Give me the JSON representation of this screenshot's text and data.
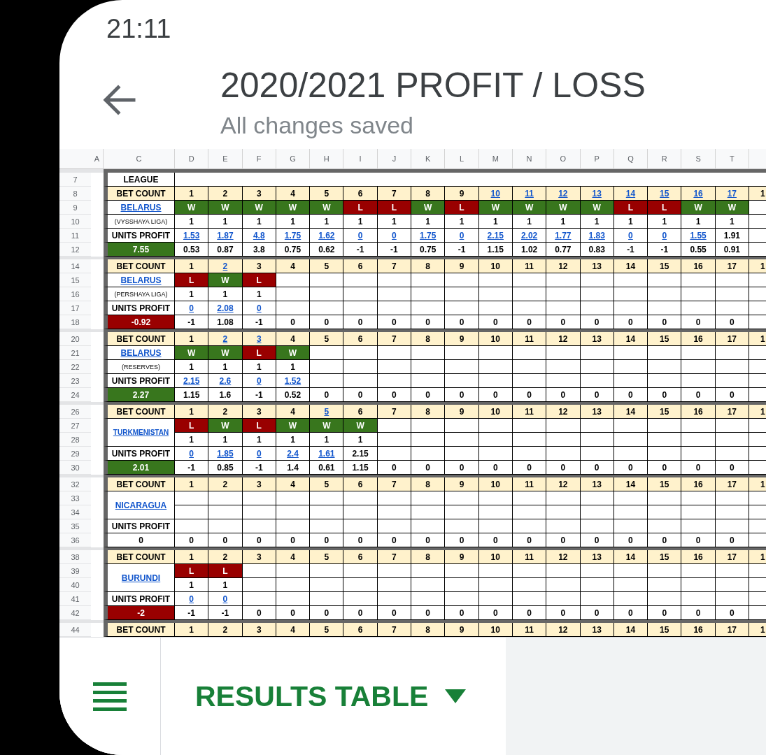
{
  "status_bar": {
    "time": "21:11"
  },
  "header": {
    "title": "2020/2021 PROFIT / LOSS",
    "subtitle": "All changes saved"
  },
  "sheet": {
    "columns": [
      "A",
      "C",
      "D",
      "E",
      "F",
      "G",
      "H",
      "I",
      "J",
      "K",
      "L",
      "M",
      "N",
      "O",
      "P",
      "Q",
      "R",
      "S",
      "T"
    ],
    "league_row": {
      "number": "7",
      "label": "LEAGUE"
    },
    "blocks": [
      {
        "rows": [
          {
            "number": "8",
            "kind": "bet_count",
            "label": "BET COUNT",
            "cells": [
              {
                "text": "1",
                "link": false
              },
              {
                "text": "2",
                "link": false
              },
              {
                "text": "3",
                "link": false
              },
              {
                "text": "4",
                "link": false
              },
              {
                "text": "5",
                "link": false
              },
              {
                "text": "6",
                "link": false
              },
              {
                "text": "7",
                "link": false
              },
              {
                "text": "8",
                "link": false
              },
              {
                "text": "9",
                "link": false
              },
              {
                "text": "10",
                "link": true
              },
              {
                "text": "11",
                "link": true
              },
              {
                "text": "12",
                "link": true
              },
              {
                "text": "13",
                "link": true
              },
              {
                "text": "14",
                "link": true
              },
              {
                "text": "15",
                "link": true
              },
              {
                "text": "16",
                "link": true
              },
              {
                "text": "17",
                "link": true
              },
              {
                "text": "1",
                "link": false
              }
            ]
          },
          {
            "number": "9",
            "kind": "result",
            "label": "BELARUS",
            "cells": [
              {
                "text": "W",
                "color": "#38761d"
              },
              {
                "text": "W",
                "color": "#38761d"
              },
              {
                "text": "W",
                "color": "#38761d"
              },
              {
                "text": "W",
                "color": "#38761d"
              },
              {
                "text": "W",
                "color": "#38761d"
              },
              {
                "text": "L",
                "color": "#990000"
              },
              {
                "text": "L",
                "color": "#990000"
              },
              {
                "text": "W",
                "color": "#38761d"
              },
              {
                "text": "L",
                "color": "#990000"
              },
              {
                "text": "W",
                "color": "#38761d"
              },
              {
                "text": "W",
                "color": "#38761d"
              },
              {
                "text": "W",
                "color": "#38761d"
              },
              {
                "text": "W",
                "color": "#38761d"
              },
              {
                "text": "L",
                "color": "#990000"
              },
              {
                "text": "L",
                "color": "#990000"
              },
              {
                "text": "W",
                "color": "#38761d"
              },
              {
                "text": "W",
                "color": "#38761d"
              }
            ]
          },
          {
            "number": "10",
            "kind": "stake",
            "label": "(VYSSHAYA LIGA)",
            "cells": [
              "1",
              "1",
              "1",
              "1",
              "1",
              "1",
              "1",
              "1",
              "1",
              "1",
              "1",
              "1",
              "1",
              "1",
              "1",
              "1",
              "1"
            ]
          },
          {
            "number": "11",
            "kind": "profit",
            "label": "UNITS PROFIT",
            "cells": [
              {
                "text": "1.53",
                "link": true
              },
              {
                "text": "1.87",
                "link": true
              },
              {
                "text": "4.8",
                "link": true
              },
              {
                "text": "1.75",
                "link": true
              },
              {
                "text": "1.62",
                "link": true
              },
              {
                "text": "0",
                "link": true
              },
              {
                "text": "0",
                "link": true
              },
              {
                "text": "1.75",
                "link": true
              },
              {
                "text": "0",
                "link": true
              },
              {
                "text": "2.15",
                "link": true
              },
              {
                "text": "2.02",
                "link": true
              },
              {
                "text": "1.77",
                "link": true
              },
              {
                "text": "1.83",
                "link": true
              },
              {
                "text": "0",
                "link": true
              },
              {
                "text": "0",
                "link": true
              },
              {
                "text": "1.55",
                "link": true
              },
              {
                "text": "1.91",
                "link": false
              }
            ]
          },
          {
            "number": "12",
            "kind": "net",
            "total": {
              "text": "7.55",
              "color": "#38761d"
            },
            "cells": [
              "0.53",
              "0.87",
              "3.8",
              "0.75",
              "0.62",
              "-1",
              "-1",
              "0.75",
              "-1",
              "1.15",
              "1.02",
              "0.77",
              "0.83",
              "-1",
              "-1",
              "0.55",
              "0.91"
            ]
          }
        ]
      },
      {
        "rows": [
          {
            "number": "14",
            "kind": "bet_count",
            "label": "BET COUNT",
            "cells": [
              {
                "text": "1",
                "link": false
              },
              {
                "text": "2",
                "link": true
              },
              {
                "text": "3",
                "link": false
              },
              {
                "text": "4",
                "link": false
              },
              {
                "text": "5",
                "link": false
              },
              {
                "text": "6",
                "link": false
              },
              {
                "text": "7",
                "link": false
              },
              {
                "text": "8",
                "link": false
              },
              {
                "text": "9",
                "link": false
              },
              {
                "text": "10",
                "link": false
              },
              {
                "text": "11",
                "link": false
              },
              {
                "text": "12",
                "link": false
              },
              {
                "text": "13",
                "link": false
              },
              {
                "text": "14",
                "link": false
              },
              {
                "text": "15",
                "link": false
              },
              {
                "text": "16",
                "link": false
              },
              {
                "text": "17",
                "link": false
              },
              {
                "text": "1",
                "link": false
              }
            ]
          },
          {
            "number": "15",
            "kind": "result",
            "label": "BELARUS",
            "cells": [
              {
                "text": "L",
                "color": "#990000"
              },
              {
                "text": "W",
                "color": "#38761d"
              },
              {
                "text": "L",
                "color": "#990000"
              }
            ]
          },
          {
            "number": "16",
            "kind": "stake",
            "label": "(PERSHAYA LIGA)",
            "cells": [
              "1",
              "1",
              "1"
            ]
          },
          {
            "number": "17",
            "kind": "profit",
            "label": "UNITS PROFIT",
            "cells": [
              {
                "text": "0",
                "link": true
              },
              {
                "text": "2.08",
                "link": true
              },
              {
                "text": "0",
                "link": true
              }
            ]
          },
          {
            "number": "18",
            "kind": "net",
            "total": {
              "text": "-0.92",
              "color": "#990000"
            },
            "cells": [
              "-1",
              "1.08",
              "-1",
              "0",
              "0",
              "0",
              "0",
              "0",
              "0",
              "0",
              "0",
              "0",
              "0",
              "0",
              "0",
              "0",
              "0"
            ]
          }
        ]
      },
      {
        "rows": [
          {
            "number": "20",
            "kind": "bet_count",
            "label": "BET COUNT",
            "cells": [
              {
                "text": "1",
                "link": false
              },
              {
                "text": "2",
                "link": true
              },
              {
                "text": "3",
                "link": true
              },
              {
                "text": "4",
                "link": false
              },
              {
                "text": "5",
                "link": false
              },
              {
                "text": "6",
                "link": false
              },
              {
                "text": "7",
                "link": false
              },
              {
                "text": "8",
                "link": false
              },
              {
                "text": "9",
                "link": false
              },
              {
                "text": "10",
                "link": false
              },
              {
                "text": "11",
                "link": false
              },
              {
                "text": "12",
                "link": false
              },
              {
                "text": "13",
                "link": false
              },
              {
                "text": "14",
                "link": false
              },
              {
                "text": "15",
                "link": false
              },
              {
                "text": "16",
                "link": false
              },
              {
                "text": "17",
                "link": false
              },
              {
                "text": "1",
                "link": false
              }
            ]
          },
          {
            "number": "21",
            "kind": "result",
            "label": "BELARUS",
            "cells": [
              {
                "text": "W",
                "color": "#38761d"
              },
              {
                "text": "W",
                "color": "#38761d"
              },
              {
                "text": "L",
                "color": "#990000"
              },
              {
                "text": "W",
                "color": "#38761d"
              }
            ]
          },
          {
            "number": "22",
            "kind": "stake",
            "label": "(RESERVES)",
            "cells": [
              "1",
              "1",
              "1",
              "1"
            ]
          },
          {
            "number": "23",
            "kind": "profit",
            "label": "UNITS PROFIT",
            "cells": [
              {
                "text": "2.15",
                "link": true
              },
              {
                "text": "2.6",
                "link": true
              },
              {
                "text": "0",
                "link": true
              },
              {
                "text": "1.52",
                "link": true
              }
            ]
          },
          {
            "number": "24",
            "kind": "net",
            "total": {
              "text": "2.27",
              "color": "#38761d"
            },
            "cells": [
              "1.15",
              "1.6",
              "-1",
              "0.52",
              "0",
              "0",
              "0",
              "0",
              "0",
              "0",
              "0",
              "0",
              "0",
              "0",
              "0",
              "0",
              "0"
            ]
          }
        ]
      },
      {
        "rows": [
          {
            "number": "26",
            "kind": "bet_count",
            "label": "BET COUNT",
            "cells": [
              {
                "text": "1",
                "link": false
              },
              {
                "text": "2",
                "link": false
              },
              {
                "text": "3",
                "link": false
              },
              {
                "text": "4",
                "link": false
              },
              {
                "text": "5",
                "link": true
              },
              {
                "text": "6",
                "link": false
              },
              {
                "text": "7",
                "link": false
              },
              {
                "text": "8",
                "link": false
              },
              {
                "text": "9",
                "link": false
              },
              {
                "text": "10",
                "link": false
              },
              {
                "text": "11",
                "link": false
              },
              {
                "text": "12",
                "link": false
              },
              {
                "text": "13",
                "link": false
              },
              {
                "text": "14",
                "link": false
              },
              {
                "text": "15",
                "link": false
              },
              {
                "text": "16",
                "link": false
              },
              {
                "text": "17",
                "link": false
              },
              {
                "text": "1",
                "link": false
              }
            ]
          },
          {
            "number": "27",
            "kind": "result",
            "label": "TURKMENISTAN",
            "cells": [
              {
                "text": "L",
                "color": "#990000"
              },
              {
                "text": "W",
                "color": "#38761d"
              },
              {
                "text": "L",
                "color": "#990000"
              },
              {
                "text": "W",
                "color": "#38761d"
              },
              {
                "text": "W",
                "color": "#38761d"
              },
              {
                "text": "W",
                "color": "#38761d"
              }
            ]
          },
          {
            "number": "28",
            "kind": "stake",
            "cells": [
              "1",
              "1",
              "1",
              "1",
              "1",
              "1"
            ]
          },
          {
            "number": "29",
            "kind": "profit",
            "label": "UNITS PROFIT",
            "cells": [
              {
                "text": "0",
                "link": true
              },
              {
                "text": "1.85",
                "link": true
              },
              {
                "text": "0",
                "link": true
              },
              {
                "text": "2.4",
                "link": true
              },
              {
                "text": "1.61",
                "link": true
              },
              {
                "text": "2.15",
                "link": false
              }
            ]
          },
          {
            "number": "30",
            "kind": "net",
            "total": {
              "text": "2.01",
              "color": "#38761d"
            },
            "cells": [
              "-1",
              "0.85",
              "-1",
              "1.4",
              "0.61",
              "1.15",
              "0",
              "0",
              "0",
              "0",
              "0",
              "0",
              "0",
              "0",
              "0",
              "0",
              "0"
            ]
          }
        ]
      },
      {
        "rows": [
          {
            "number": "32",
            "kind": "bet_count",
            "label": "BET COUNT",
            "cells": [
              {
                "text": "1",
                "link": false
              },
              {
                "text": "2",
                "link": false
              },
              {
                "text": "3",
                "link": false
              },
              {
                "text": "4",
                "link": false
              },
              {
                "text": "5",
                "link": false
              },
              {
                "text": "6",
                "link": false
              },
              {
                "text": "7",
                "link": false
              },
              {
                "text": "8",
                "link": false
              },
              {
                "text": "9",
                "link": false
              },
              {
                "text": "10",
                "link": false
              },
              {
                "text": "11",
                "link": false
              },
              {
                "text": "12",
                "link": false
              },
              {
                "text": "13",
                "link": false
              },
              {
                "text": "14",
                "link": false
              },
              {
                "text": "15",
                "link": false
              },
              {
                "text": "16",
                "link": false
              },
              {
                "text": "17",
                "link": false
              },
              {
                "text": "1",
                "link": false
              }
            ]
          },
          {
            "number": "33",
            "kind": "result",
            "label": "NICARAGUA"
          },
          {
            "number": "34",
            "kind": "stake"
          },
          {
            "number": "35",
            "kind": "profit",
            "label": "UNITS PROFIT"
          },
          {
            "number": "36",
            "kind": "net",
            "total": {
              "text": "0"
            },
            "cells": [
              "0",
              "0",
              "0",
              "0",
              "0",
              "0",
              "0",
              "0",
              "0",
              "0",
              "0",
              "0",
              "0",
              "0",
              "0",
              "0",
              "0"
            ]
          }
        ]
      },
      {
        "rows": [
          {
            "number": "38",
            "kind": "bet_count",
            "label": "BET COUNT",
            "cells": [
              {
                "text": "1",
                "link": false
              },
              {
                "text": "2",
                "link": false
              },
              {
                "text": "3",
                "link": false
              },
              {
                "text": "4",
                "link": false
              },
              {
                "text": "5",
                "link": false
              },
              {
                "text": "6",
                "link": false
              },
              {
                "text": "7",
                "link": false
              },
              {
                "text": "8",
                "link": false
              },
              {
                "text": "9",
                "link": false
              },
              {
                "text": "10",
                "link": false
              },
              {
                "text": "11",
                "link": false
              },
              {
                "text": "12",
                "link": false
              },
              {
                "text": "13",
                "link": false
              },
              {
                "text": "14",
                "link": false
              },
              {
                "text": "15",
                "link": false
              },
              {
                "text": "16",
                "link": false
              },
              {
                "text": "17",
                "link": false
              },
              {
                "text": "1",
                "link": false
              }
            ]
          },
          {
            "number": "39",
            "kind": "result",
            "label": "BURUNDI",
            "cells": [
              {
                "text": "L",
                "color": "#990000"
              },
              {
                "text": "L",
                "color": "#990000"
              }
            ]
          },
          {
            "number": "40",
            "kind": "stake",
            "cells": [
              "1",
              "1"
            ]
          },
          {
            "number": "41",
            "kind": "profit",
            "label": "UNITS PROFIT",
            "cells": [
              {
                "text": "0",
                "link": true
              },
              {
                "text": "0",
                "link": true
              }
            ]
          },
          {
            "number": "42",
            "kind": "net",
            "total": {
              "text": "-2",
              "color": "#990000"
            },
            "cells": [
              "-1",
              "-1",
              "0",
              "0",
              "0",
              "0",
              "0",
              "0",
              "0",
              "0",
              "0",
              "0",
              "0",
              "0",
              "0",
              "0",
              "0"
            ]
          }
        ]
      },
      {
        "rows": [
          {
            "number": "44",
            "kind": "bet_count",
            "label": "BET COUNT",
            "cells": [
              {
                "text": "1",
                "link": false
              },
              {
                "text": "2",
                "link": false
              },
              {
                "text": "3",
                "link": false
              },
              {
                "text": "4",
                "link": false
              },
              {
                "text": "5",
                "link": false
              },
              {
                "text": "6",
                "link": false
              },
              {
                "text": "7",
                "link": false
              },
              {
                "text": "8",
                "link": false
              },
              {
                "text": "9",
                "link": false
              },
              {
                "text": "10",
                "link": false
              },
              {
                "text": "11",
                "link": false
              },
              {
                "text": "12",
                "link": false
              },
              {
                "text": "13",
                "link": false
              },
              {
                "text": "14",
                "link": false
              },
              {
                "text": "15",
                "link": false
              },
              {
                "text": "16",
                "link": false
              },
              {
                "text": "17",
                "link": false
              },
              {
                "text": "1",
                "link": false
              }
            ]
          }
        ]
      }
    ]
  },
  "tab_bar": {
    "tabs": [
      {
        "label": "RESULTS TABLE",
        "selected": true
      }
    ]
  }
}
